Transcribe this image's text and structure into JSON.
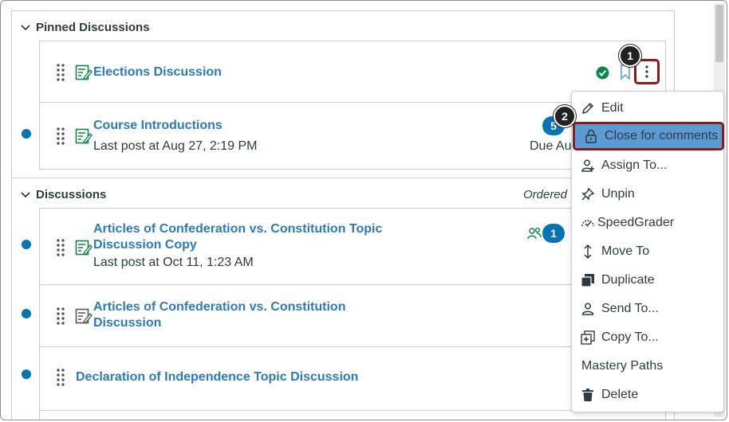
{
  "sections": {
    "pinned_title": "Pinned Discussions",
    "discussions_title": "Discussions",
    "ordered_label": "Ordered"
  },
  "pinned": [
    {
      "title": "Elections Discussion"
    },
    {
      "title": "Course Introductions",
      "last_post": "Last post at Aug 27, 2:19 PM",
      "unread": "5",
      "due": "Due Au"
    }
  ],
  "discussions": [
    {
      "title_line1": "Articles of Confederation vs. Constitution Topic",
      "title_line2": "Discussion Copy",
      "last_post": "Last post at Oct 11, 1:23 AM",
      "unread": "1"
    },
    {
      "title_line1": "Articles of Confederation vs. Constitution",
      "title_line2": "Discussion"
    },
    {
      "title": "Declaration of Independence Topic Discussion"
    }
  ],
  "callouts": {
    "one": "1",
    "two": "2"
  },
  "menu": {
    "items": [
      {
        "label": "Edit",
        "icon": "pencil-icon"
      },
      {
        "label": "Close for comments",
        "icon": "lock-icon"
      },
      {
        "label": "Assign To...",
        "icon": "assign-user-icon"
      },
      {
        "label": "Unpin",
        "icon": "pin-icon"
      },
      {
        "label": "SpeedGrader",
        "icon": "speedgrader-icon"
      },
      {
        "label": "Move To",
        "icon": "move-arrows-icon"
      },
      {
        "label": "Duplicate",
        "icon": "duplicate-icon"
      },
      {
        "label": "Send To...",
        "icon": "send-user-icon"
      },
      {
        "label": "Copy To...",
        "icon": "copy-icon"
      },
      {
        "label": "Mastery Paths",
        "icon": ""
      },
      {
        "label": "Delete",
        "icon": "trash-icon"
      }
    ]
  },
  "colors": {
    "link": "#2b7abc",
    "accent": "#0374b5",
    "published": "#0b874b",
    "highlight": "#5b9bd1",
    "callout_border": "#8b1a1a"
  }
}
